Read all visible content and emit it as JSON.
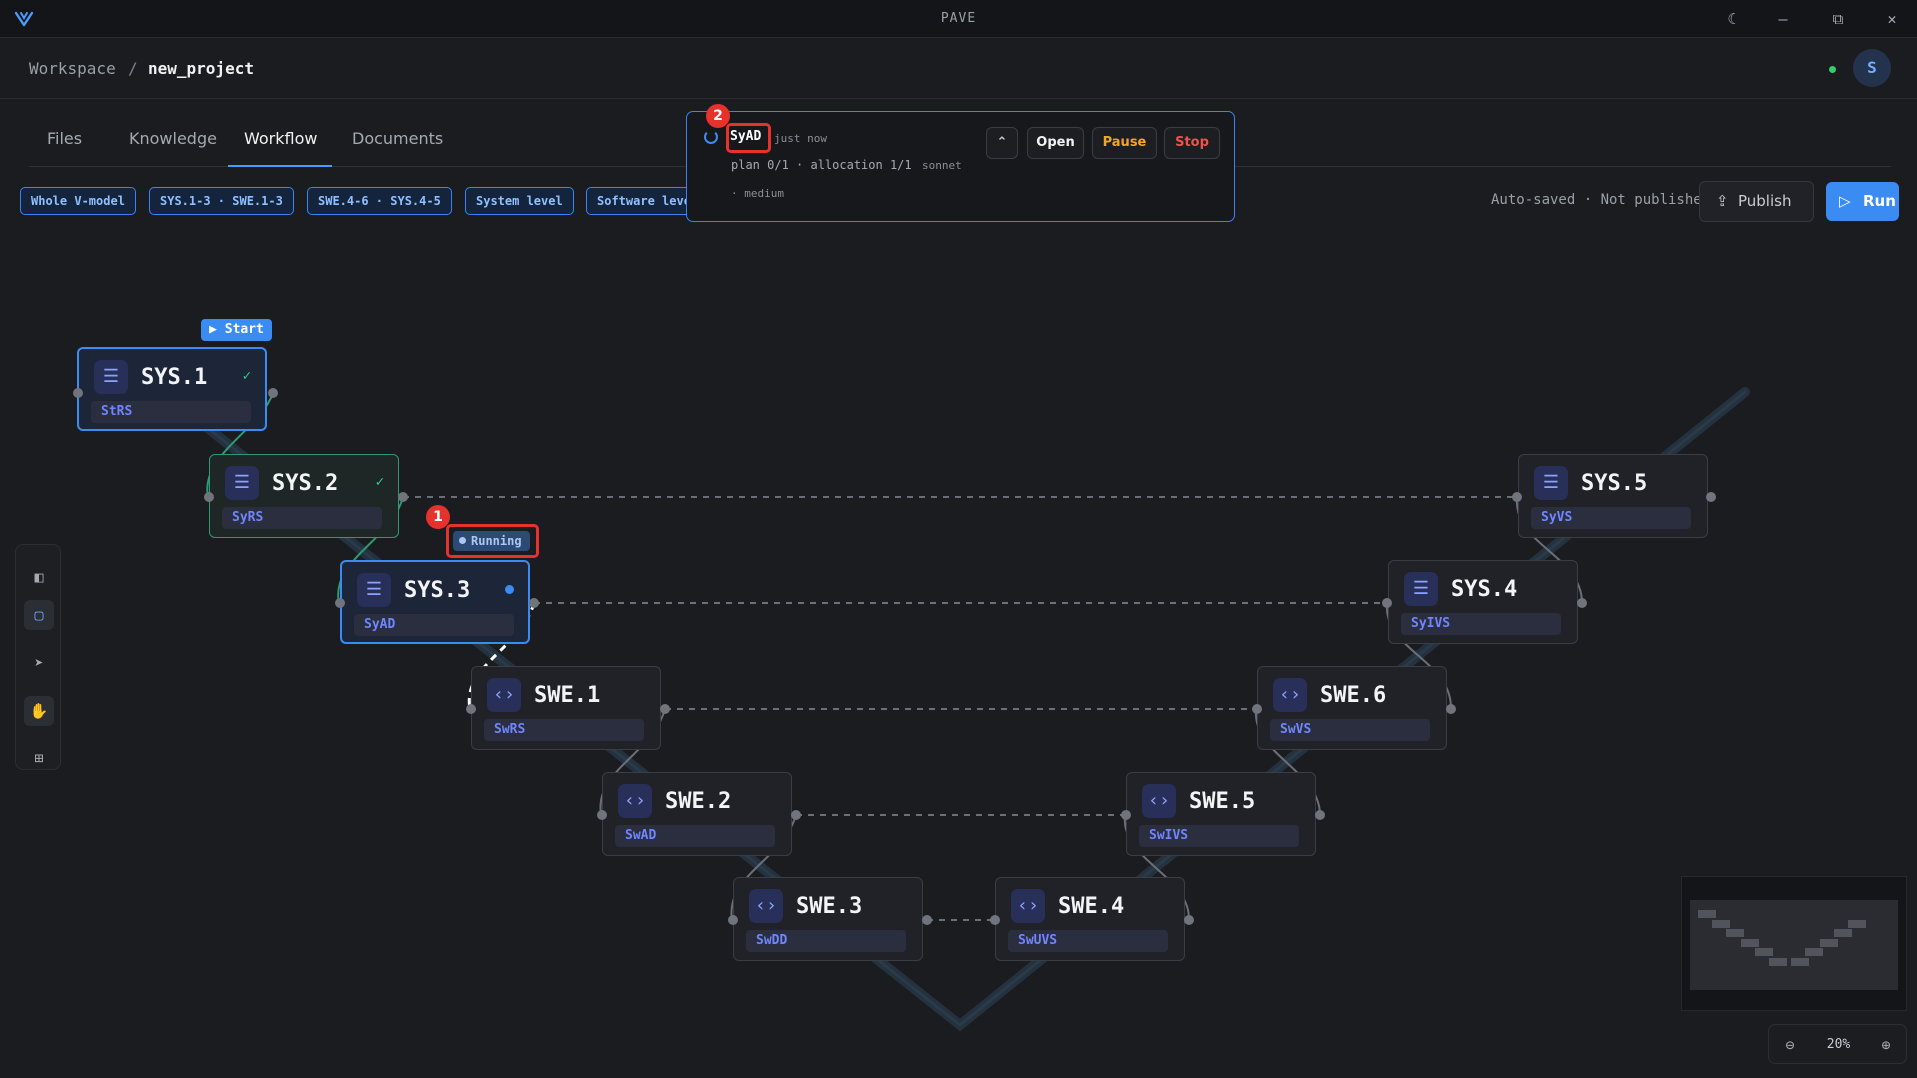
{
  "app": {
    "title": "PAVE"
  },
  "breadcrumb": {
    "workspace": "Workspace",
    "separator": "/",
    "project": "new_project"
  },
  "user": {
    "initial": "S",
    "online": true
  },
  "tabs": [
    {
      "label": "Files",
      "active": false
    },
    {
      "label": "Knowledge",
      "active": false
    },
    {
      "label": "Workflow",
      "active": true
    },
    {
      "label": "Documents",
      "active": false
    }
  ],
  "filters": [
    {
      "label": "Whole V-model"
    },
    {
      "label": "SYS.1-3 · SWE.1-3"
    },
    {
      "label": "SWE.4-6 · SYS.4-5"
    },
    {
      "label": "System level"
    },
    {
      "label": "Software level"
    }
  ],
  "toolbar": {
    "status": "Auto-saved · Not published",
    "publish_label": "Publish",
    "run_label": "Run"
  },
  "popup": {
    "title": "SyAD",
    "time": "just now",
    "plan": "plan 0/1 · allocation 1/1",
    "model": "sonnet",
    "effort": "· medium",
    "open_label": "Open",
    "pause_label": "Pause",
    "stop_label": "Stop"
  },
  "nodes": {
    "sys1": {
      "title": "SYS.1",
      "subtitle": "StRS",
      "state": "done"
    },
    "sys2": {
      "title": "SYS.2",
      "subtitle": "SyRS",
      "state": "done"
    },
    "sys3": {
      "title": "SYS.3",
      "subtitle": "SyAD",
      "state": "running"
    },
    "sys4": {
      "title": "SYS.4",
      "subtitle": "SyIVS",
      "state": "idle"
    },
    "sys5": {
      "title": "SYS.5",
      "subtitle": "SyVS",
      "state": "idle"
    },
    "swe1": {
      "title": "SWE.1",
      "subtitle": "SwRS",
      "state": "idle"
    },
    "swe2": {
      "title": "SWE.2",
      "subtitle": "SwAD",
      "state": "idle"
    },
    "swe3": {
      "title": "SWE.3",
      "subtitle": "SwDD",
      "state": "idle"
    },
    "swe4": {
      "title": "SWE.4",
      "subtitle": "SwUVS",
      "state": "idle"
    },
    "swe5": {
      "title": "SWE.5",
      "subtitle": "SwIVS",
      "state": "idle"
    },
    "swe6": {
      "title": "SWE.6",
      "subtitle": "SwVS",
      "state": "idle"
    }
  },
  "badges": {
    "start": "▶ Start",
    "running": "Running"
  },
  "markers": {
    "one": "1",
    "two": "2"
  },
  "zoom": {
    "value": "20%"
  },
  "colors": {
    "accent": "#3b8cf2",
    "done": "#2e9a74",
    "danger": "#e5322d",
    "pause": "#f5a524"
  },
  "icons": {
    "layers": "layers-icon",
    "code": "code-icon",
    "collapse": "chevron-up-icon",
    "theme": "moon-icon"
  }
}
